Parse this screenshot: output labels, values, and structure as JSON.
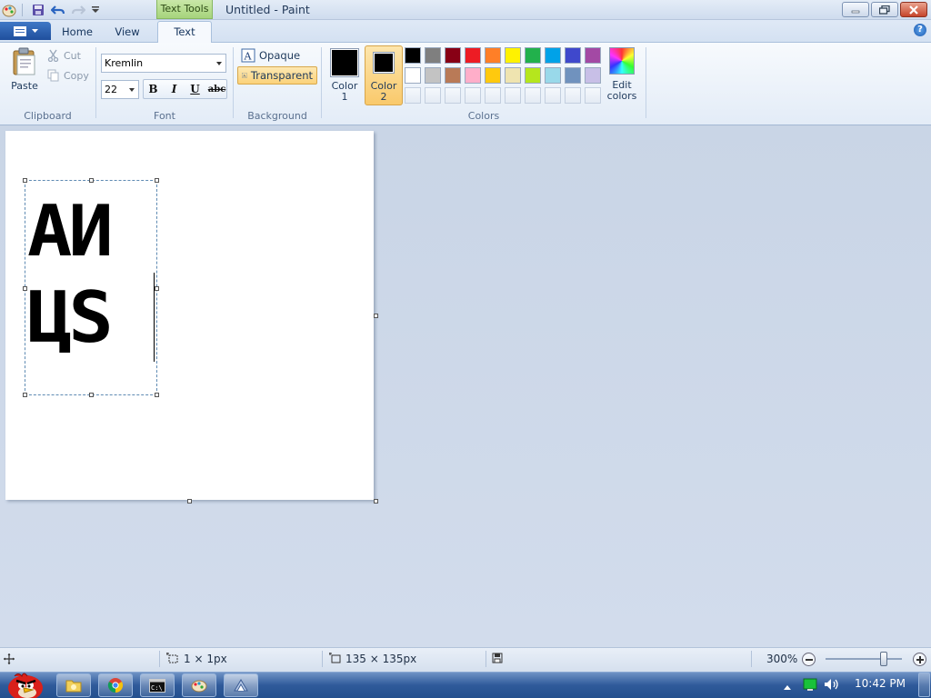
{
  "window": {
    "title": "Untitled - Paint",
    "context_tab": "Text Tools",
    "controls": {
      "minimize": "minimize",
      "maximize": "restore",
      "close": "close"
    }
  },
  "tabs": [
    {
      "label": "Home"
    },
    {
      "label": "View"
    },
    {
      "label": "Text",
      "active": true
    }
  ],
  "clipboard": {
    "paste_label": "Paste",
    "cut_label": "Cut",
    "copy_label": "Copy",
    "group_label": "Clipboard"
  },
  "font": {
    "family_value": "Kremlin",
    "size_value": "22",
    "bold_glyph": "B",
    "italic_glyph": "I",
    "underline_glyph": "U",
    "strike_glyph": "abc",
    "group_label": "Font"
  },
  "background": {
    "opaque_label": "Opaque",
    "transparent_label": "Transparent",
    "selected": "Transparent",
    "group_label": "Background"
  },
  "colors": {
    "color1_label": "Color\n1",
    "color2_label": "Color\n2",
    "color1": "#000000",
    "color2": "#000000",
    "palette_row1": [
      "#000000",
      "#7f7f7f",
      "#880015",
      "#ed1c24",
      "#ff7f27",
      "#fff200",
      "#22b14c",
      "#00a2e8",
      "#3f48cc",
      "#a349a4"
    ],
    "palette_row2": [
      "#ffffff",
      "#c3c3c3",
      "#b97a57",
      "#ffaec9",
      "#ffc90e",
      "#efe4b0",
      "#b5e61d",
      "#99d9ea",
      "#7092be",
      "#c8bfe7"
    ],
    "palette_row3_empty": 10,
    "edit_label": "Edit\ncolors",
    "group_label": "Colors"
  },
  "canvas": {
    "text_line1": "AИ",
    "text_line2": "ЦS"
  },
  "status": {
    "cursor_pos": "",
    "selection_size": "1 × 1px",
    "image_size": "135 × 135px",
    "zoom": "300%",
    "zoom_level_percent": 300
  },
  "taskbar": {
    "clock": "10:42 PM",
    "apps": [
      "explorer",
      "chrome",
      "cmd",
      "paint",
      "app"
    ]
  },
  "accent": {
    "ribbon_active": "#fbd487",
    "titlebar": "#d3e0f1",
    "taskbar": "#2f5a9a"
  }
}
